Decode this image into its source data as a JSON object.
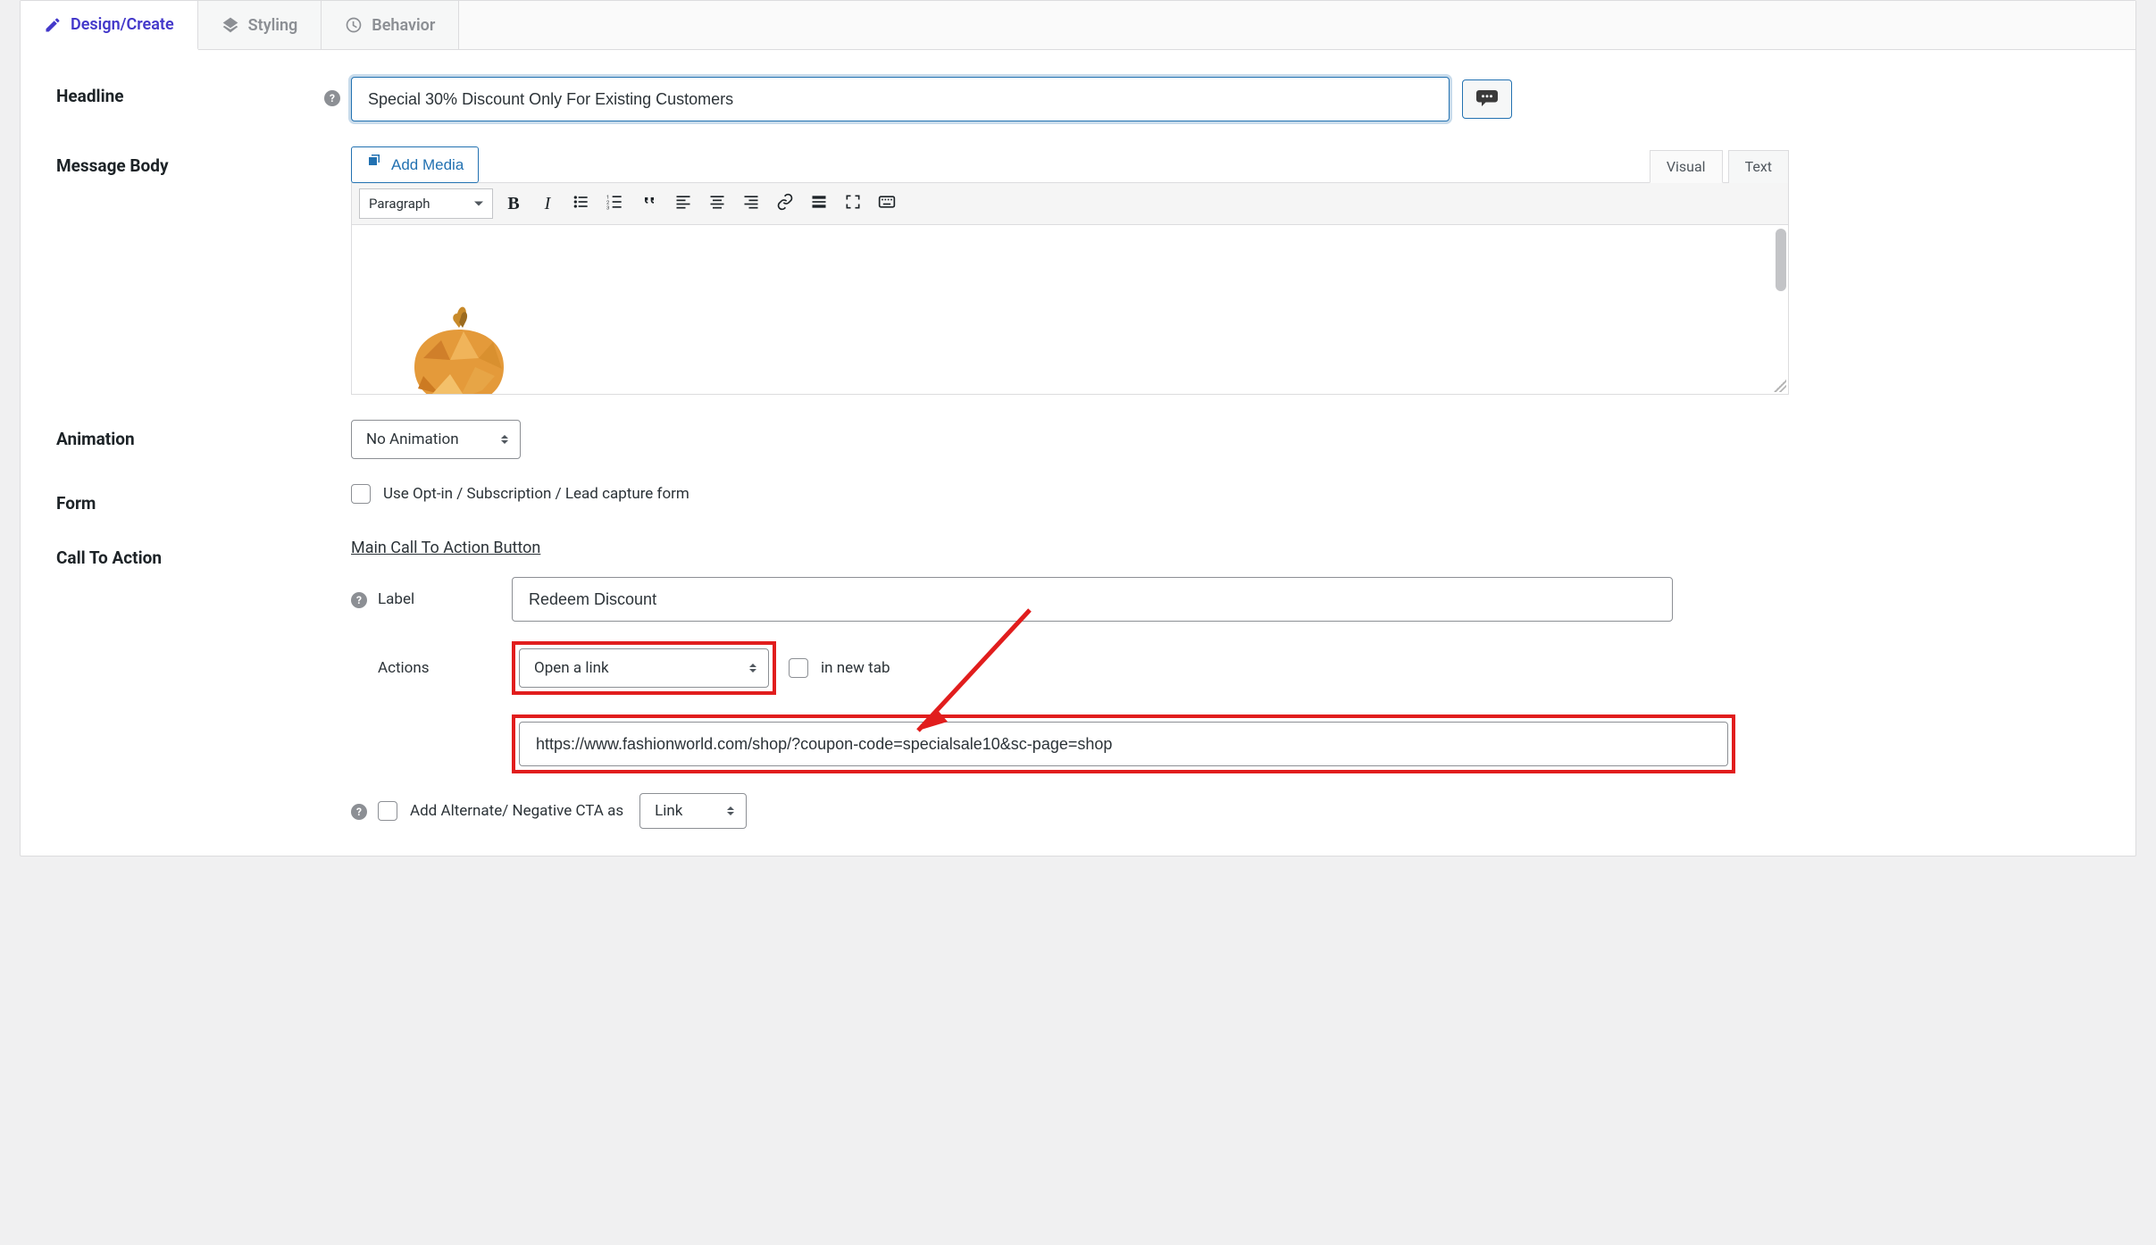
{
  "tabs": {
    "design": "Design/Create",
    "styling": "Styling",
    "behavior": "Behavior"
  },
  "labels": {
    "headline": "Headline",
    "message_body": "Message Body",
    "animation": "Animation",
    "form": "Form",
    "cta": "Call To Action"
  },
  "headline": {
    "value": "Special 30% Discount Only For Existing Customers"
  },
  "editor": {
    "add_media": "Add Media",
    "mode_visual": "Visual",
    "mode_text": "Text",
    "format": "Paragraph"
  },
  "animation": {
    "value": "No Animation"
  },
  "form": {
    "optin_label": "Use Opt-in / Subscription / Lead capture form"
  },
  "cta": {
    "main_heading": "Main Call To Action Button",
    "label_label": "Label",
    "label_value": "Redeem Discount",
    "actions_label": "Actions",
    "action_value": "Open a link",
    "new_tab_label": "in new tab",
    "url_value": "https://www.fashionworld.com/shop/?coupon-code=specialsale10&sc-page=shop",
    "alt_label": "Add Alternate/ Negative CTA as",
    "alt_type": "Link"
  }
}
